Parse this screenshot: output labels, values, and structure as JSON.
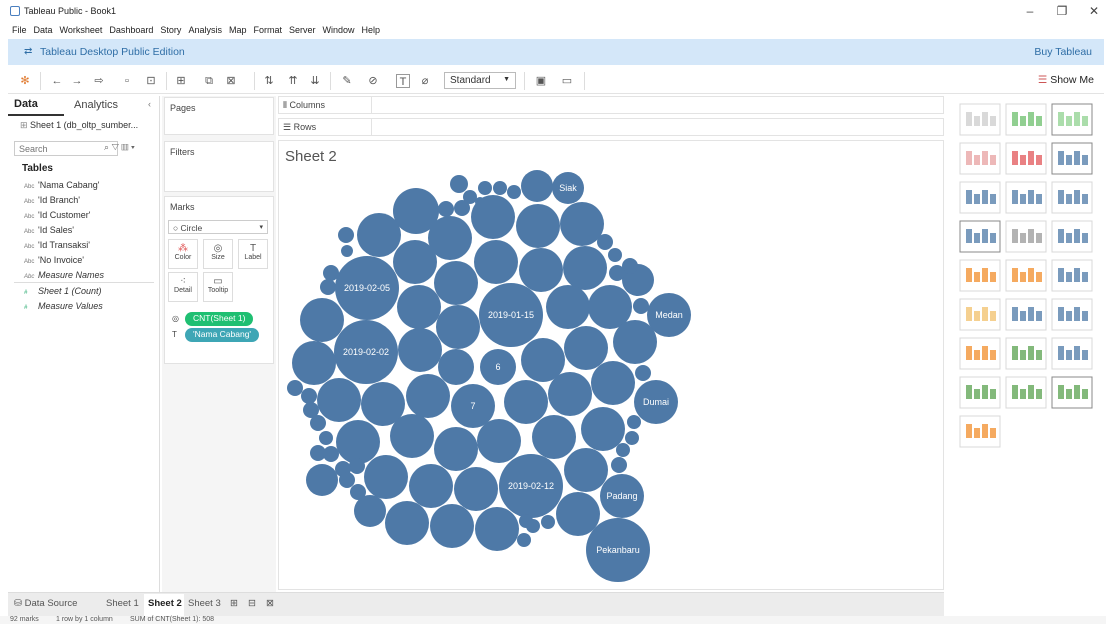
{
  "window": {
    "title": "Tableau Public - Book1",
    "minimize": "–",
    "restore": "❐",
    "close": "✕"
  },
  "menu": [
    "File",
    "Data",
    "Worksheet",
    "Dashboard",
    "Story",
    "Analysis",
    "Map",
    "Format",
    "Server",
    "Window",
    "Help"
  ],
  "edition": {
    "label": "Tableau Desktop Public Edition",
    "buy": "Buy Tableau"
  },
  "toolbar": {
    "fit": "Standard",
    "show_me": "Show Me"
  },
  "data_pane": {
    "tab_data": "Data",
    "tab_analytics": "Analytics",
    "source": "Sheet 1 (db_oltp_sumber...",
    "search_placeholder": "Search",
    "tables_heading": "Tables",
    "fields": [
      {
        "type": "Abc",
        "name": "'Nama Cabang'"
      },
      {
        "type": "Abc",
        "name": "'Id Branch'"
      },
      {
        "type": "Abc",
        "name": "'Id Customer'"
      },
      {
        "type": "Abc",
        "name": "'Id Sales'"
      },
      {
        "type": "Abc",
        "name": "'Id Transaksi'"
      },
      {
        "type": "Abc",
        "name": "'No Invoice'"
      },
      {
        "type": "Abc",
        "name": "Measure Names"
      }
    ],
    "measures": [
      {
        "type": "#",
        "name": "Sheet 1 (Count)"
      },
      {
        "type": "#",
        "name": "Measure Values"
      }
    ]
  },
  "cards": {
    "pages": "Pages",
    "filters": "Filters",
    "marks": "Marks",
    "mark_type": "Circle",
    "buttons": [
      {
        "label": "Color"
      },
      {
        "label": "Size"
      },
      {
        "label": "Label"
      },
      {
        "label": "Detail"
      },
      {
        "label": "Tooltip"
      }
    ],
    "pill_size": "CNT(Sheet 1)",
    "pill_label": "'Nama Cabang'"
  },
  "shelves": {
    "columns": "Columns",
    "rows": "Rows"
  },
  "sheet": {
    "title": "Sheet 2"
  },
  "chart_data": {
    "type": "packed-bubble",
    "mark_color": "#4e79a7",
    "labeled_bubbles": [
      "Siak",
      "2019-02-05",
      "2019-01-15",
      "Medan",
      "2019-02-02",
      "6",
      "7",
      "Dumai",
      "2019-02-12",
      "Padang",
      "Pekanbaru"
    ]
  },
  "bottom_tabs": {
    "data_source": "Data Source",
    "sheets": [
      "Sheet 1",
      "Sheet 2",
      "Sheet 3"
    ],
    "active": "Sheet 2"
  },
  "status": {
    "marks": "92 marks",
    "dims": "1 row by 1 column",
    "sum": "SUM of CNT(Sheet 1): 508"
  }
}
